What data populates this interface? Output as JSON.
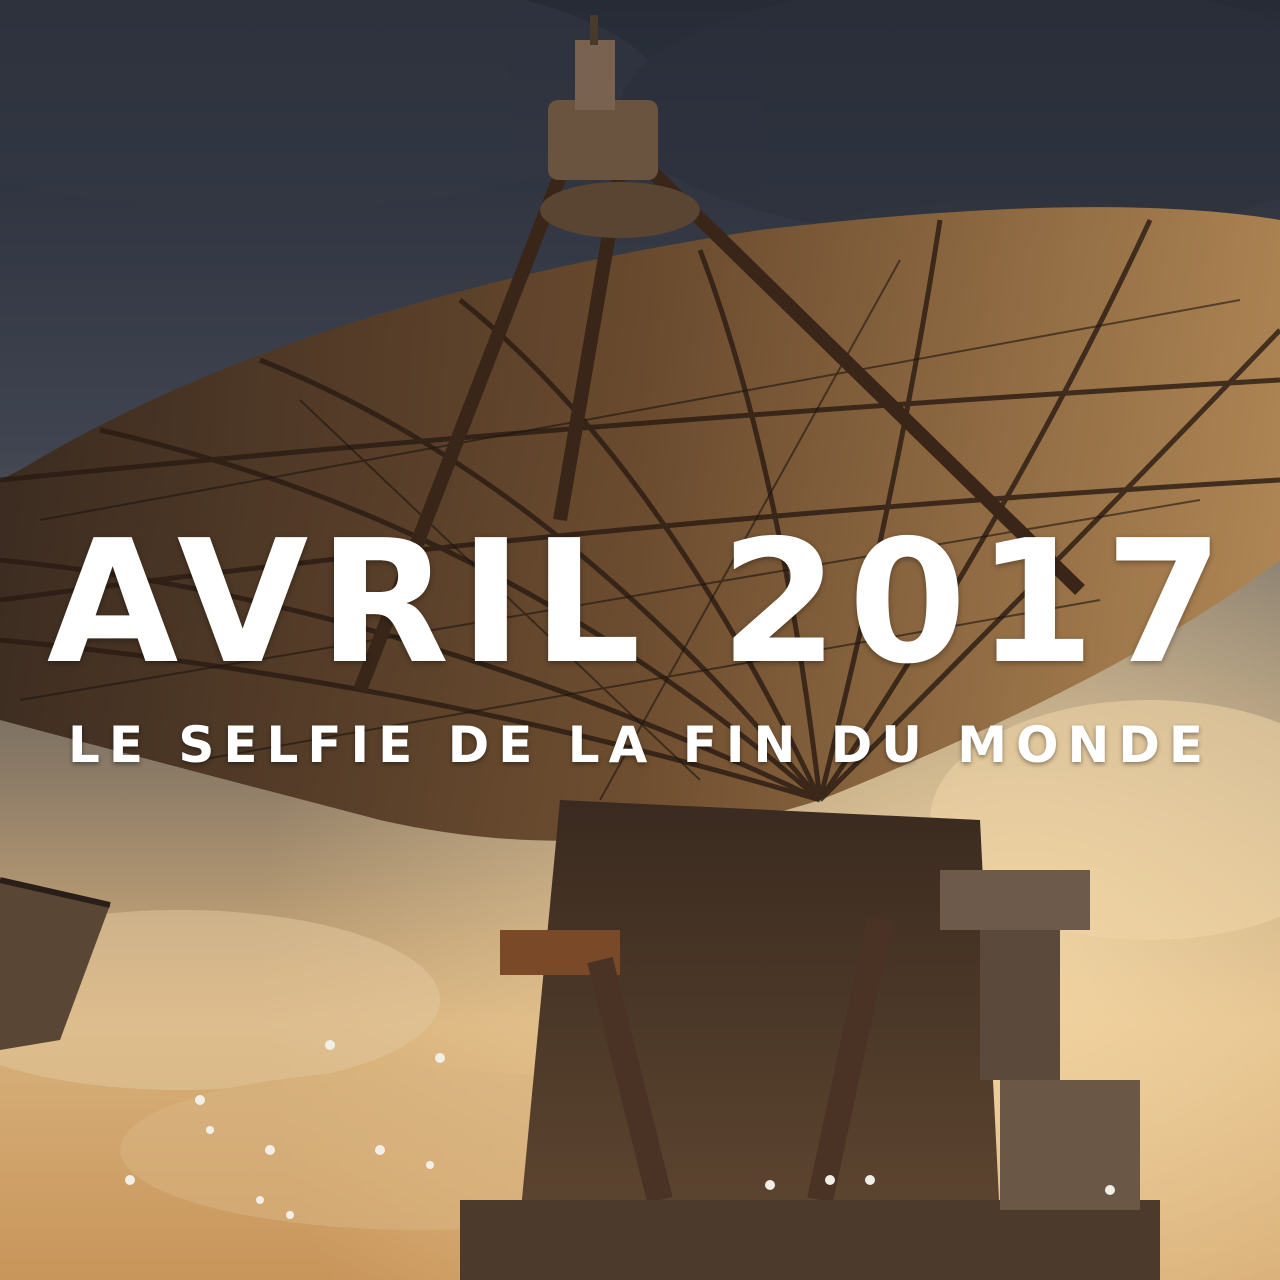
{
  "poster": {
    "headline": "AVRIL 2017",
    "subtitle": "LE SELFIE DE LA FIN DU MONDE"
  },
  "scene": {
    "subject": "rusted-radio-telescope-icon",
    "colors": {
      "sky_top": "#2b3140",
      "sky_mid": "#4a4e58",
      "sky_glow": "#e9c58e",
      "rust": "#5a3a22",
      "rust_light": "#a8703c",
      "text": "#ffffff"
    }
  }
}
